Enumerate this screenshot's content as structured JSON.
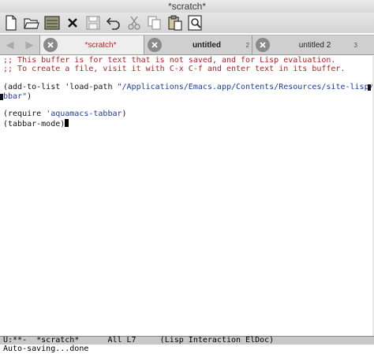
{
  "window": {
    "title": "*scratch*"
  },
  "toolbar": {
    "buttons": [
      {
        "name": "new-file",
        "icon": "new-document-icon"
      },
      {
        "name": "open-file",
        "icon": "folder-open-icon"
      },
      {
        "name": "save-list",
        "icon": "buffer-list-icon"
      },
      {
        "name": "close",
        "icon": "close-x-icon",
        "glyph": "✕"
      },
      {
        "name": "save",
        "icon": "floppy-disk-icon"
      },
      {
        "name": "undo",
        "icon": "undo-arrow-icon"
      },
      {
        "name": "cut",
        "icon": "scissors-icon"
      },
      {
        "name": "copy",
        "icon": "copy-pages-icon"
      },
      {
        "name": "paste",
        "icon": "clipboard-icon"
      },
      {
        "name": "search",
        "icon": "magnifier-icon"
      }
    ]
  },
  "tabs": {
    "nav_prev": "◀",
    "nav_next": "▶",
    "items": [
      {
        "label": "*scratch*",
        "number": "",
        "active": true
      },
      {
        "label": "untitled",
        "number": "2",
        "active": false
      },
      {
        "label": "untitled 2",
        "number": "3",
        "active": false
      }
    ]
  },
  "editor": {
    "lines": [
      {
        "kind": "comment",
        "text": ";; This buffer is for text that is not saved, and for Lisp evaluation."
      },
      {
        "kind": "comment",
        "text": ";; To create a file, visit it with C-x C-f and enter text in its buffer."
      },
      {
        "kind": "blank",
        "text": ""
      },
      {
        "kind": "code",
        "prefix": "(add-to-list 'load-path ",
        "string": "\"/Applications/Emacs.app/Contents/Resources/site-lisp/ta",
        "suffix": ""
      },
      {
        "kind": "code",
        "prefix": "",
        "string": "bbar\"",
        "suffix": ")"
      },
      {
        "kind": "blank",
        "text": ""
      },
      {
        "kind": "code",
        "prefix": "(require ",
        "string": "'aquamacs-tabbar",
        "suffix": ")"
      },
      {
        "kind": "code",
        "prefix": "(tabbar-mode)",
        "string": "",
        "suffix": ""
      }
    ]
  },
  "modeline": {
    "text": "U:**-  *scratch*      All L7     (Lisp Interaction ElDoc)"
  },
  "minibuffer": {
    "text": "Auto-saving...done"
  },
  "colors": {
    "comment": "#b22222",
    "string": "#1e3c9b",
    "active_tab_text": "#e0141e"
  }
}
